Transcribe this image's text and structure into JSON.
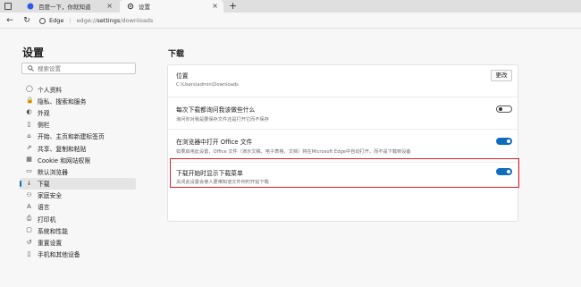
{
  "browser": {
    "tabs": [
      {
        "label": "百度一下，你就知道",
        "active": false
      },
      {
        "label": "设置",
        "active": true
      }
    ],
    "address": {
      "site_label": "Edge",
      "url_prefix": "edge://",
      "url_main": "settings",
      "url_suffix": "/downloads"
    }
  },
  "sidebar": {
    "title": "设置",
    "search_placeholder": "搜索设置",
    "items": [
      {
        "label": "个人资料",
        "icon": "profile-icon",
        "glyph": "◯"
      },
      {
        "label": "隐私、搜索和服务",
        "icon": "lock-icon",
        "glyph": "🔒"
      },
      {
        "label": "外观",
        "icon": "appearance-icon",
        "glyph": "◐"
      },
      {
        "label": "侧栏",
        "icon": "sidebar-icon",
        "glyph": "▯"
      },
      {
        "label": "开始、主页和新建标签页",
        "icon": "home-icon",
        "glyph": "⌂"
      },
      {
        "label": "共享、复制和粘贴",
        "icon": "share-icon",
        "glyph": "⇗"
      },
      {
        "label": "Cookie 和网站权限",
        "icon": "cookie-icon",
        "glyph": "▦"
      },
      {
        "label": "默认浏览器",
        "icon": "browser-icon",
        "glyph": "▭"
      },
      {
        "label": "下载",
        "icon": "download-icon",
        "glyph": "↓"
      },
      {
        "label": "家庭安全",
        "icon": "family-icon",
        "glyph": "⚇"
      },
      {
        "label": "语言",
        "icon": "language-icon",
        "glyph": "A"
      },
      {
        "label": "打印机",
        "icon": "printer-icon",
        "glyph": "⎙"
      },
      {
        "label": "系统和性能",
        "icon": "system-icon",
        "glyph": "▢"
      },
      {
        "label": "重置设置",
        "icon": "reset-icon",
        "glyph": "↺"
      },
      {
        "label": "手机和其他设备",
        "icon": "phone-icon",
        "glyph": "▯"
      }
    ],
    "active_index": 8
  },
  "main": {
    "title": "下载",
    "rows": [
      {
        "title": "位置",
        "subtitle": "C:\\Users\\admin\\Downloads",
        "control": "button",
        "button_label": "更改"
      },
      {
        "title": "每次下载都询问我该做些什么",
        "subtitle": "询问你对我是要保存文件还是打开它而不保存",
        "control": "toggle",
        "on": false
      },
      {
        "title": "在浏览器中打开 Office 文件",
        "subtitle": "如果启用此设置，Office 文件（演示文稿、电子表格、文档）将在Microsoft Edge中自动打开，而不是下载到设备",
        "control": "toggle",
        "on": true
      },
      {
        "title": "下载开始时显示下载菜单",
        "subtitle": "关闭此设置会使人更难知道文件何时开始下载",
        "control": "toggle",
        "on": true,
        "highlighted": true
      }
    ]
  },
  "colors": {
    "accent": "#0f6cbd",
    "highlight": "#e0202a"
  }
}
